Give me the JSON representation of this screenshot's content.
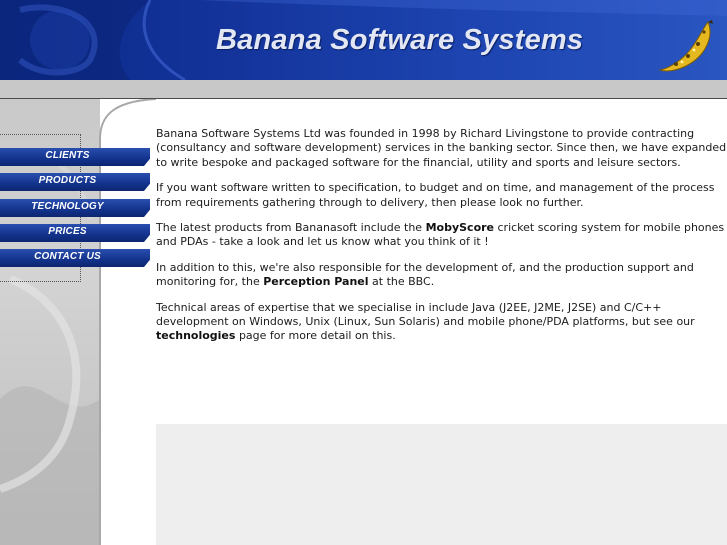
{
  "header": {
    "title": "Banana Software Systems",
    "colors": {
      "banner": "#13339a",
      "title_text": "#e3e7f4",
      "gray_bar": "#c8c8c8",
      "nav_button": "#14348e"
    },
    "logo_icon": "banana-logo-icon"
  },
  "nav": {
    "items": [
      {
        "label": "CLIENTS"
      },
      {
        "label": "PRODUCTS"
      },
      {
        "label": "TECHNOLOGY"
      },
      {
        "label": "PRICES"
      },
      {
        "label": "CONTACT US"
      }
    ]
  },
  "content": {
    "p1": "Banana Software Systems Ltd was founded in 1998 by Richard Livingstone to provide contracting (consultancy and software development) services in the banking sector. Since then, we have expanded to write bespoke and packaged software for the financial, utility and sports and leisure sectors.",
    "p2": "If you want software written to specification, to budget and on time, and management of the process from requirements gathering through to delivery, then please look no further.",
    "p3": {
      "before": "The latest products from Bananasoft include the ",
      "link": "MobyScore",
      "after": " cricket scoring system for mobile phones and PDAs - take a look and let us know what you think of it !"
    },
    "p4": {
      "before": "In addition to this, we're also responsible for the development of, and the production support and monitoring for, the ",
      "link": "Perception Panel",
      "after": " at the BBC."
    },
    "p5": {
      "before": "Technical areas of expertise that we specialise in include Java (J2EE, J2ME, J2SE) and C/C++ development on Windows, Unix (Linux, Sun Solaris) and mobile phone/PDA platforms, but see our ",
      "link": "technologies",
      "after": " page for more detail on this."
    }
  }
}
